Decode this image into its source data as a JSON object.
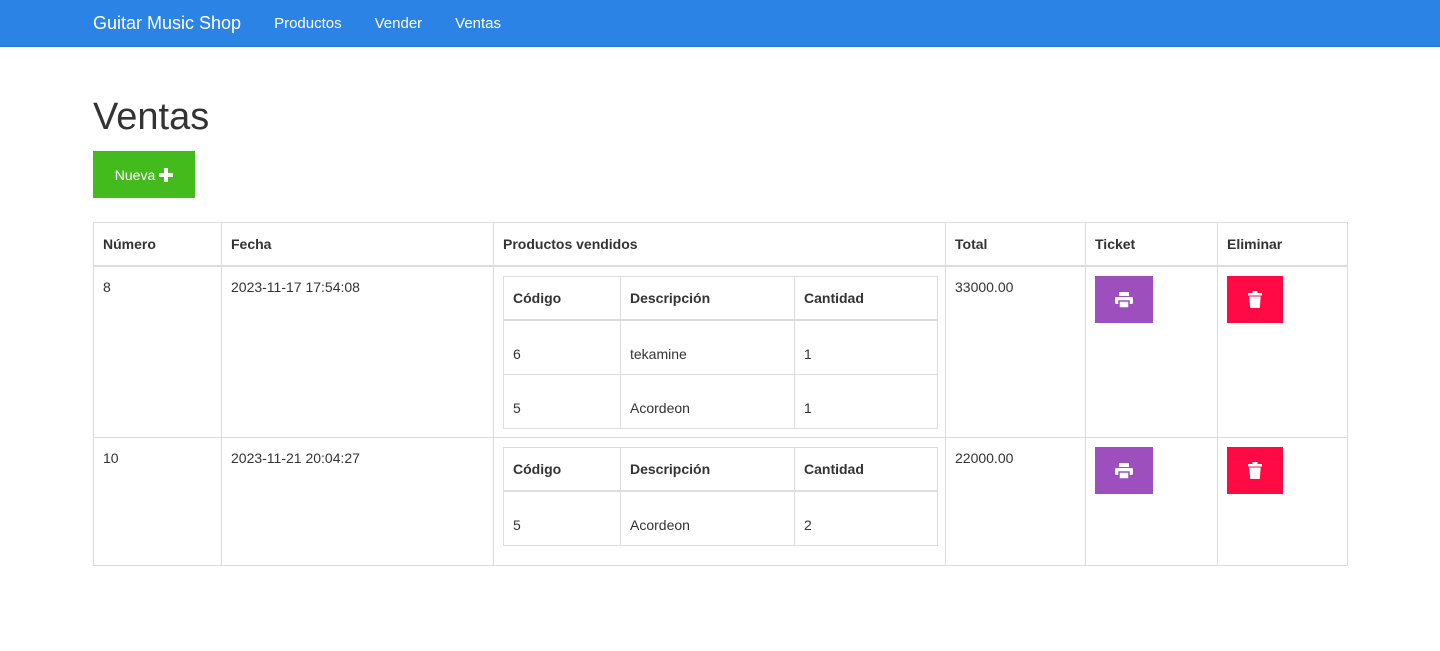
{
  "nav": {
    "brand": "Guitar Music Shop",
    "links": [
      "Productos",
      "Vender",
      "Ventas"
    ]
  },
  "page": {
    "title": "Ventas",
    "new_button_label": "Nueva"
  },
  "colors": {
    "navbar": "#2b84e5",
    "new_button": "#44bb1c",
    "ticket_button": "#9c4fbd",
    "delete_button": "#ff0a45"
  },
  "icons": {
    "new_button": "plus-icon",
    "ticket": "printer-icon",
    "delete": "trash-icon"
  },
  "table": {
    "headers": [
      "Número",
      "Fecha",
      "Productos vendidos",
      "Total",
      "Ticket",
      "Eliminar"
    ],
    "product_headers": [
      "Código",
      "Descripción",
      "Cantidad"
    ],
    "rows": [
      {
        "numero": "8",
        "fecha": "2023-11-17 17:54:08",
        "productos": [
          {
            "codigo": "6",
            "descripcion": "tekamine",
            "cantidad": "1"
          },
          {
            "codigo": "5",
            "descripcion": "Acordeon",
            "cantidad": "1"
          }
        ],
        "total": "33000.00"
      },
      {
        "numero": "10",
        "fecha": "2023-11-21 20:04:27",
        "productos": [
          {
            "codigo": "5",
            "descripcion": "Acordeon",
            "cantidad": "2"
          }
        ],
        "total": "22000.00"
      }
    ]
  }
}
